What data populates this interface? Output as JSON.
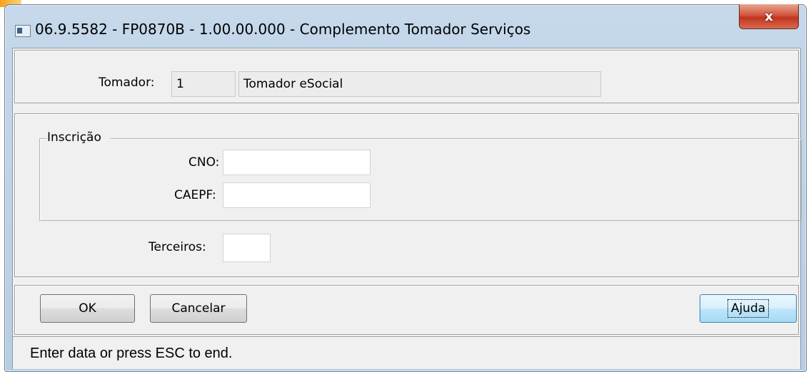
{
  "window": {
    "title": "06.9.5582 - FP0870B - 1.00.00.000 - Complemento Tomador Serviços",
    "close_label": "x",
    "icons": {
      "app": "app-window-icon",
      "close": "close-icon"
    }
  },
  "tomador": {
    "label": "Tomador:",
    "code": "1",
    "name": "Tomador eSocial"
  },
  "inscricao": {
    "legend": "Inscrição",
    "cno_label": "CNO:",
    "cno_value": "",
    "caepf_label": "CAEPF:",
    "caepf_value": ""
  },
  "terceiros": {
    "label": "Terceiros:",
    "value": ""
  },
  "buttons": {
    "ok": "OK",
    "cancel": "Cancelar",
    "help": "Ajuda"
  },
  "status": {
    "text": "Enter data or press ESC to end."
  },
  "colors": {
    "frame": "#c6d8ea",
    "client": "#f0f0f0",
    "close": "#c1341e",
    "default_button": "#bee6fd"
  }
}
